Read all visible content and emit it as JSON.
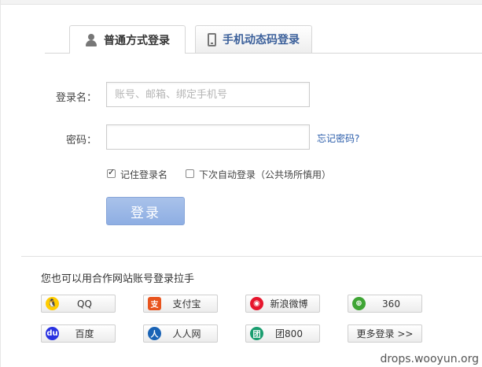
{
  "tabs": {
    "normal": {
      "label": "普通方式登录",
      "icon": "user-icon"
    },
    "sms": {
      "label": "手机动态码登录",
      "icon": "phone-icon"
    }
  },
  "form": {
    "username_label": "登录名：",
    "username_placeholder": "账号、邮箱、绑定手机号",
    "username_value": "",
    "password_label": "密码：",
    "password_value": "",
    "forgot_link": "忘记密码?",
    "remember_label": "记住登录名",
    "remember_checked": true,
    "auto_login_label": "下次自动登录（公共场所慎用）",
    "auto_login_checked": false,
    "login_button": "登录"
  },
  "partners": {
    "title": "您也可以用合作网站账号登录拉手",
    "buttons": [
      {
        "label": "QQ",
        "icon": "qq-icon"
      },
      {
        "label": "支付宝",
        "icon": "alipay-icon"
      },
      {
        "label": "新浪微博",
        "icon": "weibo-icon"
      },
      {
        "label": "360",
        "icon": "360-icon"
      },
      {
        "label": "百度",
        "icon": "baidu-icon"
      },
      {
        "label": "人人网",
        "icon": "renren-icon"
      },
      {
        "label": "团800",
        "icon": "tuan800-icon"
      },
      {
        "label": "更多登录 >>",
        "icon": ""
      }
    ]
  },
  "watermark": "drops.wooyun.org",
  "colors": {
    "link": "#2a5caa",
    "login_button": "#8eaee3",
    "qq": "#1a1a1a",
    "alipay": "#e8541e",
    "weibo": "#e6162d",
    "360": "#3fa535",
    "baidu": "#2932e1",
    "renren": "#1a63b5",
    "tuan800": "#1a9d6f"
  }
}
